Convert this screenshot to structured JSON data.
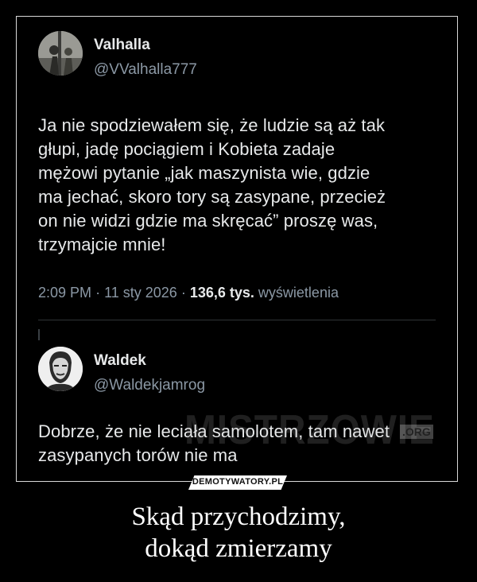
{
  "post1": {
    "name": "Valhalla",
    "handle": "@VValhalla777",
    "text": "Ja nie spodziewałem się, że ludzie są aż tak\ngłupi, jadę pociągiem i Kobieta zadaje\nmężowi pytanie „jak maszynista wie, gdzie\nma jechać, skoro tory są zasypane, przecież\non nie widzi gdzie ma skręcać” proszę was,\ntrzymajcie mnie!",
    "time": "2:09 PM",
    "date": "11 sty 2026",
    "views": "136,6 tys.",
    "views_label": "wyświetlenia",
    "separator": "·"
  },
  "post2": {
    "name": "Waldek",
    "handle": "@Waldekjamrog",
    "text": "Dobrze, że nie leciała samolotem, tam nawet\nzasypanych torów nie ma"
  },
  "watermark": {
    "main": "MISTRZOWIE",
    "suffix": ".ORG"
  },
  "site_logo": "DEMOTYWATORY.PL",
  "caption": {
    "line1": "Skąd przychodzimy,",
    "line2": "dokąd zmierzamy"
  }
}
